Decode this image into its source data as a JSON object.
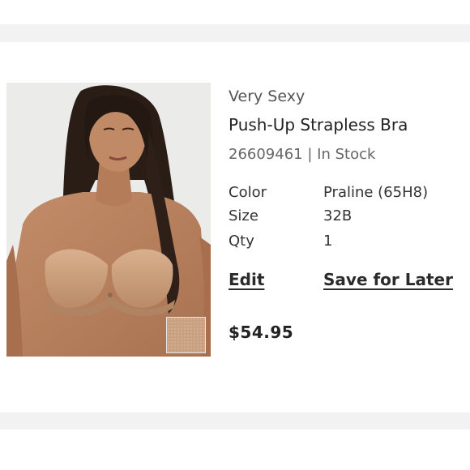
{
  "product": {
    "collection": "Very Sexy",
    "name": "Push-Up Strapless Bra",
    "sku": "26609461",
    "sku_separator": "|",
    "stock_status": "In Stock",
    "price": "$54.95",
    "photo": "model-wearing-strapless-bra",
    "swatch_color": "#c9a180"
  },
  "attributes": {
    "color_label": "Color",
    "color_value": "Praline (65H8)",
    "size_label": "Size",
    "size_value": "32B",
    "qty_label": "Qty",
    "qty_value": "1"
  },
  "actions": {
    "edit_label": "Edit",
    "save_label": "Save for Later"
  }
}
